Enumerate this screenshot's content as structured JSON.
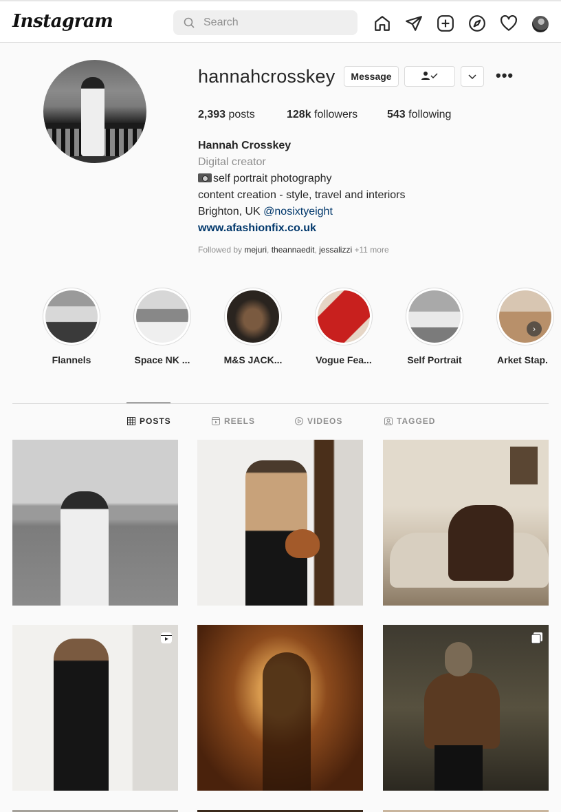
{
  "nav": {
    "logo": "Instagram",
    "search_placeholder": "Search",
    "icons": [
      "home-icon",
      "direct-icon",
      "new-post-icon",
      "explore-icon",
      "activity-icon",
      "profile-avatar"
    ]
  },
  "profile": {
    "username": "hannahcrosskey",
    "buttons": {
      "message": "Message",
      "more": "⌄"
    },
    "stats": {
      "posts_count": "2,393",
      "posts_label": "posts",
      "followers_count": "128k",
      "followers_label": "followers",
      "following_count": "543",
      "following_label": "following"
    },
    "bio": {
      "name": "Hannah Crosskey",
      "category": "Digital creator",
      "line1": "self portrait photography",
      "line2": "content creation - style, travel and interiors",
      "line3_prefix": "Brighton, UK ",
      "line3_mention": "@nosixtyeight",
      "link": "www.afashionfix.co.uk"
    },
    "followed_by": {
      "prefix": "Followed by ",
      "accounts": [
        "mejuri",
        "theannaedit",
        "jessalizzi"
      ],
      "more": "+11 more"
    }
  },
  "highlights": [
    {
      "label": "Flannels"
    },
    {
      "label": "Space NK ..."
    },
    {
      "label": "M&S JACK..."
    },
    {
      "label": "Vogue Fea..."
    },
    {
      "label": "Self Portrait"
    },
    {
      "label": "Arket Stap."
    }
  ],
  "tabs": [
    {
      "label": "POSTS",
      "icon": "grid-icon",
      "active": true
    },
    {
      "label": "REELS",
      "icon": "reels-icon",
      "active": false
    },
    {
      "label": "VIDEOS",
      "icon": "video-icon",
      "active": false
    },
    {
      "label": "TAGGED",
      "icon": "tagged-icon",
      "active": false
    }
  ],
  "colors": {
    "link": "#00376b",
    "muted": "#8e8e8e",
    "text": "#262626",
    "border": "#dbdbdb"
  }
}
